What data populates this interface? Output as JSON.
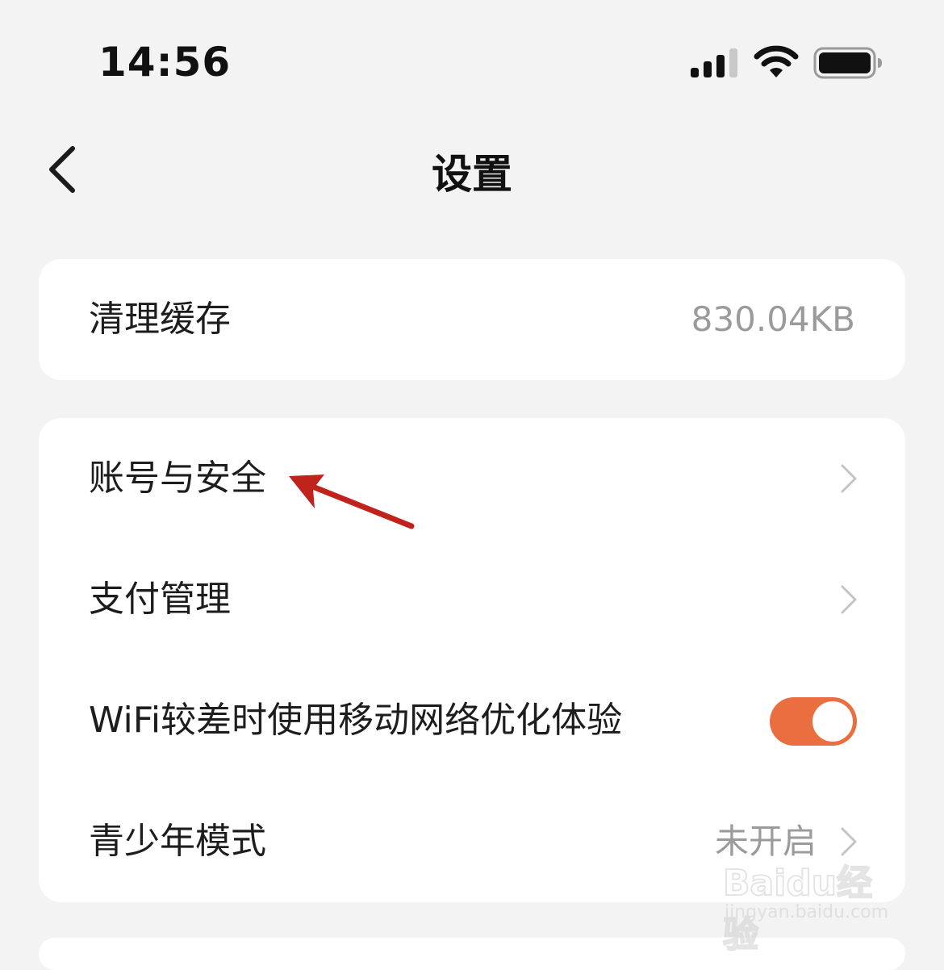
{
  "status_bar": {
    "time": "14:56",
    "icons": [
      "cellular-signal-icon",
      "wifi-icon",
      "battery-icon"
    ]
  },
  "nav": {
    "title": "设置",
    "back_icon": "chevron-left-icon"
  },
  "cache_section": {
    "label": "清理缓存",
    "value": "830.04KB"
  },
  "settings_list": [
    {
      "label": "账号与安全",
      "value": "",
      "control": "chevron"
    },
    {
      "label": "支付管理",
      "value": "",
      "control": "chevron"
    },
    {
      "label": "WiFi较差时使用移动网络优化体验",
      "value": "",
      "control": "toggle",
      "toggle_on": true
    },
    {
      "label": "青少年模式",
      "value": "未开启",
      "control": "chevron"
    }
  ],
  "annotation": {
    "type": "red-arrow",
    "points_to": "账号与安全"
  },
  "watermark": {
    "logo": "Baidu经验",
    "url": "jingyan.baidu.com"
  },
  "colors": {
    "background": "#f3f3f3",
    "card": "#ffffff",
    "toggle_on": "#ea6e3f",
    "secondary_text": "#9b9b9b",
    "chevron": "#c4c4c4",
    "annotation_arrow": "#c0231c"
  }
}
